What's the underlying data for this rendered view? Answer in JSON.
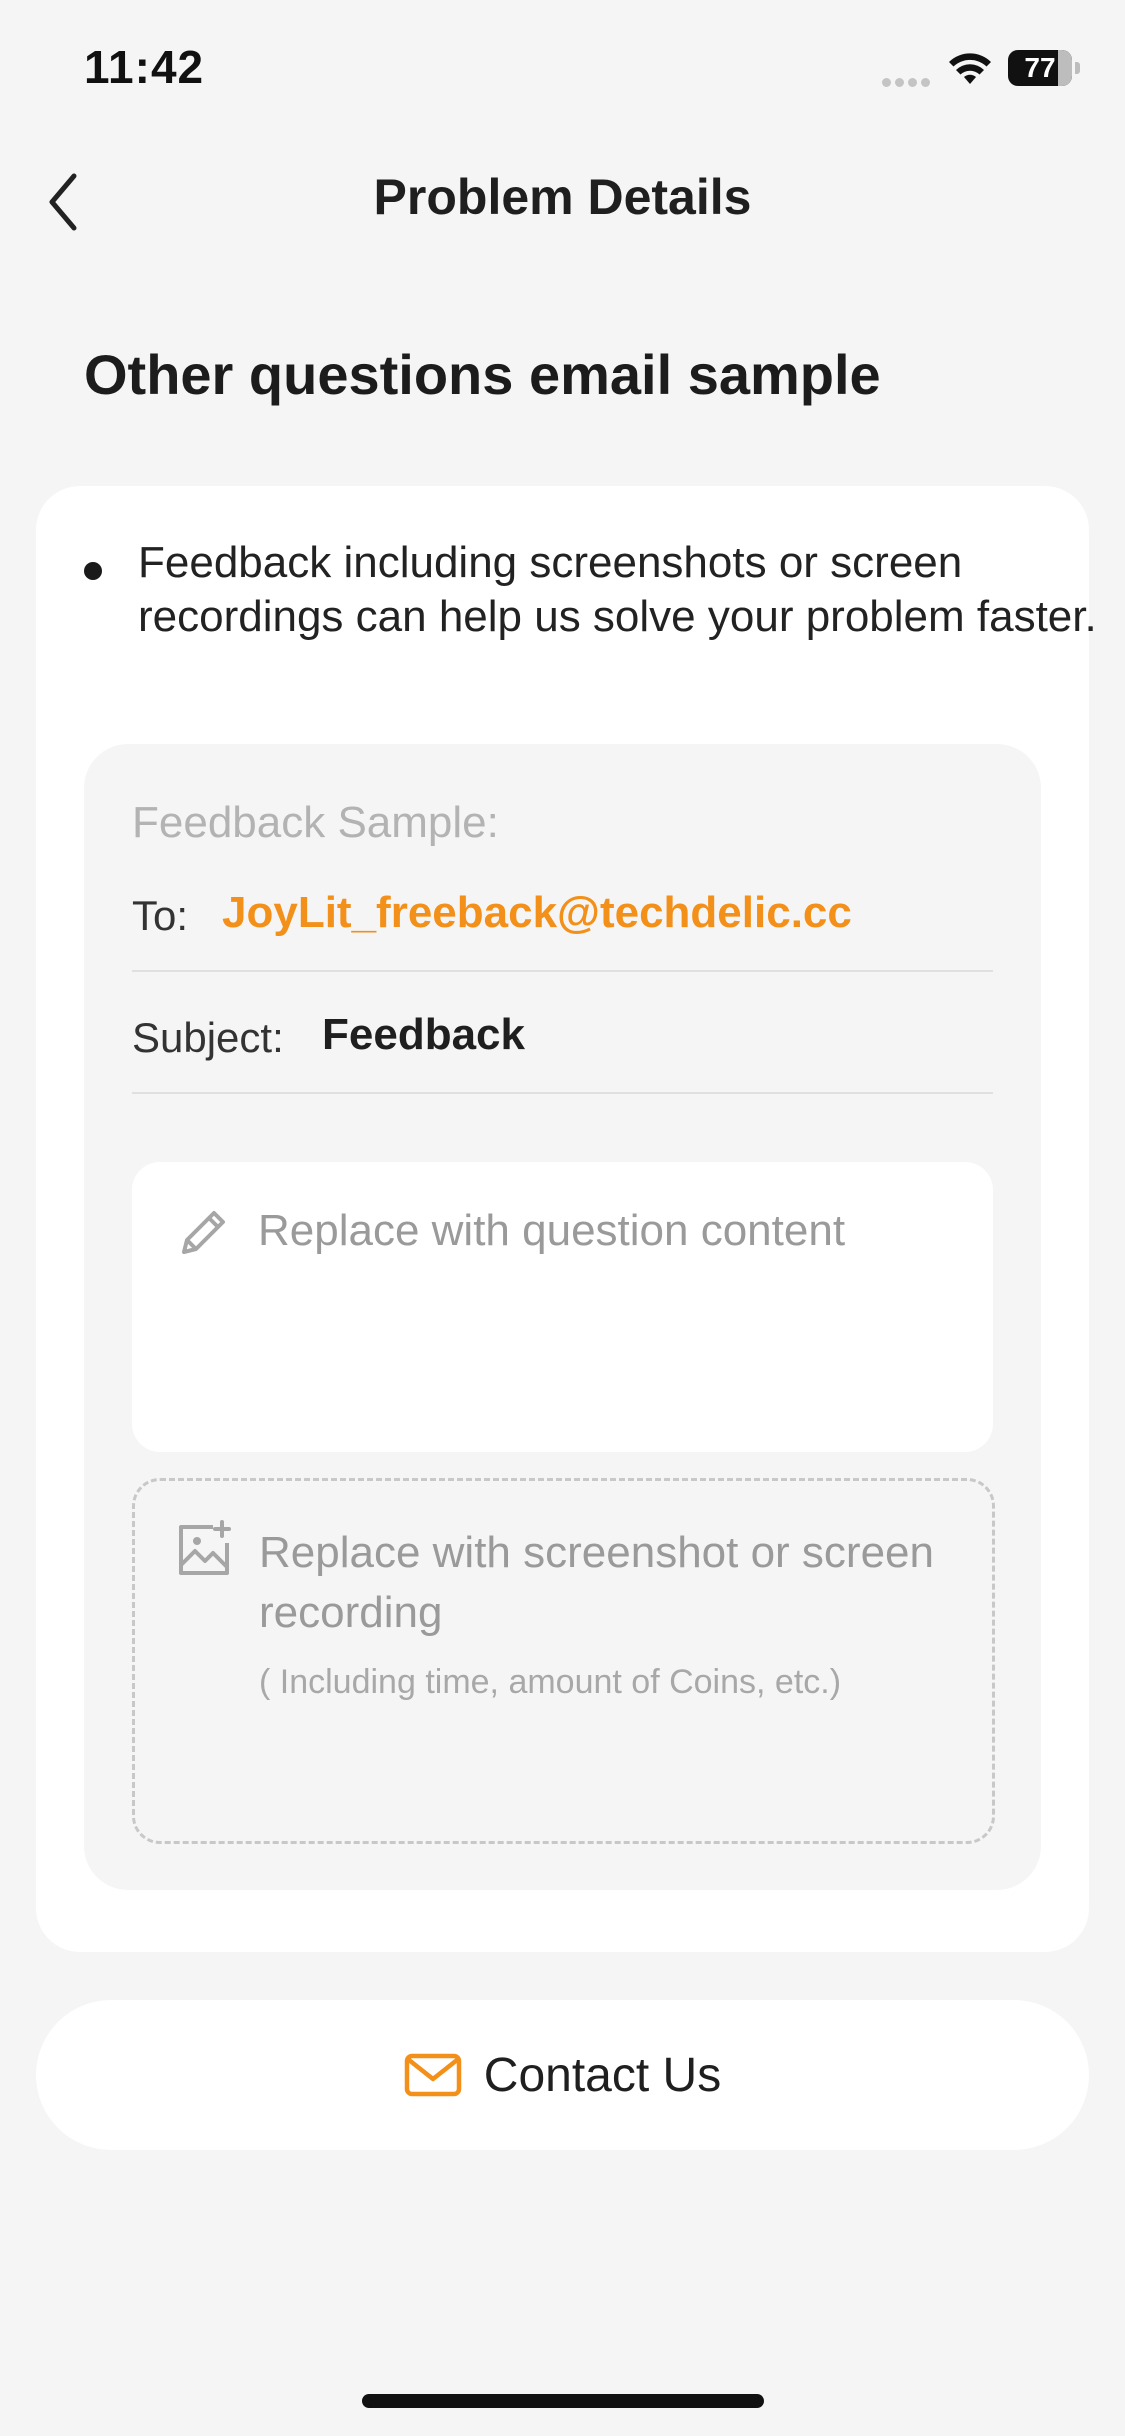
{
  "status_bar": {
    "time": "11:42",
    "battery_percent": "77"
  },
  "nav": {
    "title": "Problem Details",
    "back_icon": "chevron-left-icon"
  },
  "section": {
    "title": "Other questions email sample"
  },
  "card": {
    "bullet_text": "Feedback including screenshots or screen recordings can help us solve your problem faster.",
    "sample": {
      "heading": "Feedback Sample:",
      "to_label": "To:",
      "to_value": "JoyLit_freeback@techdelic.cc",
      "subject_label": "Subject:",
      "subject_value": "Feedback",
      "question_placeholder": "Replace with question content",
      "question_icon": "pencil-icon",
      "media_placeholder": "Replace with screenshot or screen recording",
      "media_hint": "( Including time, amount of Coins, etc.)",
      "media_icon": "image-add-icon"
    }
  },
  "contact": {
    "label": "Contact Us",
    "icon": "mail-icon"
  },
  "colors": {
    "accent": "#f39019",
    "background": "#f5f5f5",
    "card": "#ffffff"
  }
}
